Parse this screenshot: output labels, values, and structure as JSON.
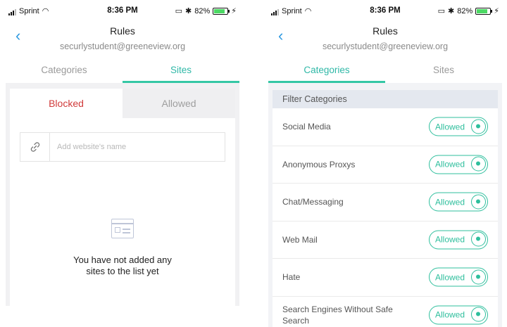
{
  "status": {
    "carrier": "Sprint",
    "time": "8:36 PM",
    "battery": "82%"
  },
  "left": {
    "title": "Rules",
    "email": "securlystudent@greeneview.org",
    "tabs": [
      "Categories",
      "Sites"
    ],
    "active_tab": "Sites",
    "segment": {
      "blocked": "Blocked",
      "allowed": "Allowed"
    },
    "input_placeholder": "Add website's name",
    "empty_line1": "You have not added any",
    "empty_line2": "sites to the list yet"
  },
  "right": {
    "title": "Rules",
    "email": "securlystudent@greeneview.org",
    "tabs": [
      "Categories",
      "Sites"
    ],
    "active_tab": "Categories",
    "filter_header": "Filter Categories",
    "categories": [
      {
        "label": "Social Media",
        "state": "Allowed"
      },
      {
        "label": "Anonymous Proxys",
        "state": "Allowed"
      },
      {
        "label": "Chat/Messaging",
        "state": "Allowed"
      },
      {
        "label": "Web Mail",
        "state": "Allowed"
      },
      {
        "label": "Hate",
        "state": "Allowed"
      },
      {
        "label": "Search Engines Without Safe Search",
        "state": "Allowed"
      }
    ]
  },
  "colors": {
    "accent": "#35c7a5",
    "link": "#2f9ae0",
    "blocked": "#d03a3a"
  },
  "icons": {
    "back": "chevron-left-icon",
    "link": "link-icon",
    "empty": "browser-window-icon",
    "wifi": "wifi-icon",
    "bluetooth": "bluetooth-icon",
    "screen": "screen-mirror-icon",
    "charging": "bolt-icon"
  }
}
